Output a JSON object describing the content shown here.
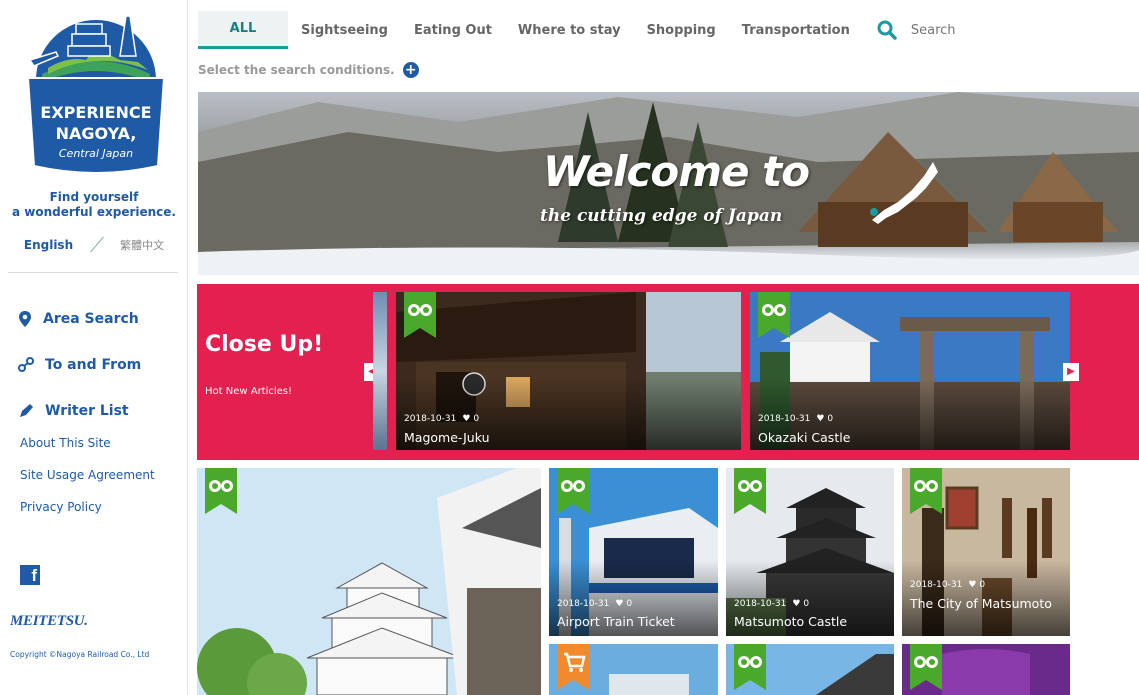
{
  "sidebar": {
    "logo_lines": [
      "EXPERIENCE",
      "NAGOYA,",
      "Central Japan"
    ],
    "tagline_1": "Find yourself",
    "tagline_2": "a wonderful experience.",
    "lang_en": "English",
    "lang_zh": "繁體中文",
    "nav": [
      {
        "label": "Area Search",
        "icon": "location-pin-icon"
      },
      {
        "label": "To and From",
        "icon": "route-icon"
      },
      {
        "label": "Writer List",
        "icon": "pen-icon"
      }
    ],
    "links": [
      "About This Site",
      "Site Usage Agreement",
      "Privacy Policy"
    ],
    "facebook_glyph": "f",
    "brand": "MEITETSU.",
    "copyright": "Copyright ©Nagoya Railroad Co., Ltd"
  },
  "topnav": {
    "tabs": [
      "ALL",
      "Sightseeing",
      "Eating Out",
      "Where to stay",
      "Shopping",
      "Transportation"
    ],
    "active_tab": "ALL",
    "search_placeholder": "Search",
    "conditions": "Select the search conditions."
  },
  "hero": {
    "title": "Welcome to",
    "subtitle": "the cutting edge of Japan"
  },
  "closeup": {
    "title": "Close Up!",
    "subtitle": "Hot New Articles!",
    "prev_glyph": "◀",
    "next_glyph": "▶",
    "cards": [
      {
        "date": "2018-10-31",
        "likes": "0",
        "title": "Magome-Juku",
        "badge": "binoculars-icon"
      },
      {
        "date": "2018-10-31",
        "likes": "0",
        "title": "Okazaki Castle",
        "badge": "binoculars-icon"
      }
    ]
  },
  "grid": {
    "tiles": [
      {
        "date": "2018-10-31",
        "likes": "0",
        "title": "Airport Train Ticket",
        "badge": "binoculars-icon"
      },
      {
        "date": "2018-10-31",
        "likes": "0",
        "title": "Matsumoto Castle",
        "badge": "binoculars-icon"
      },
      {
        "date": "2018-10-31",
        "likes": "0",
        "title": "The City of Matsumoto",
        "badge": "binoculars-icon"
      }
    ],
    "bottom_badges": [
      "cart-icon",
      "binoculars-icon",
      "binoculars-icon"
    ]
  },
  "colors": {
    "brand_blue": "#1f5aa6",
    "accent_teal": "#1b9aa0",
    "closeup_red": "#e3204f",
    "badge_green": "#4aa82a",
    "badge_orange": "#f08a2c"
  }
}
